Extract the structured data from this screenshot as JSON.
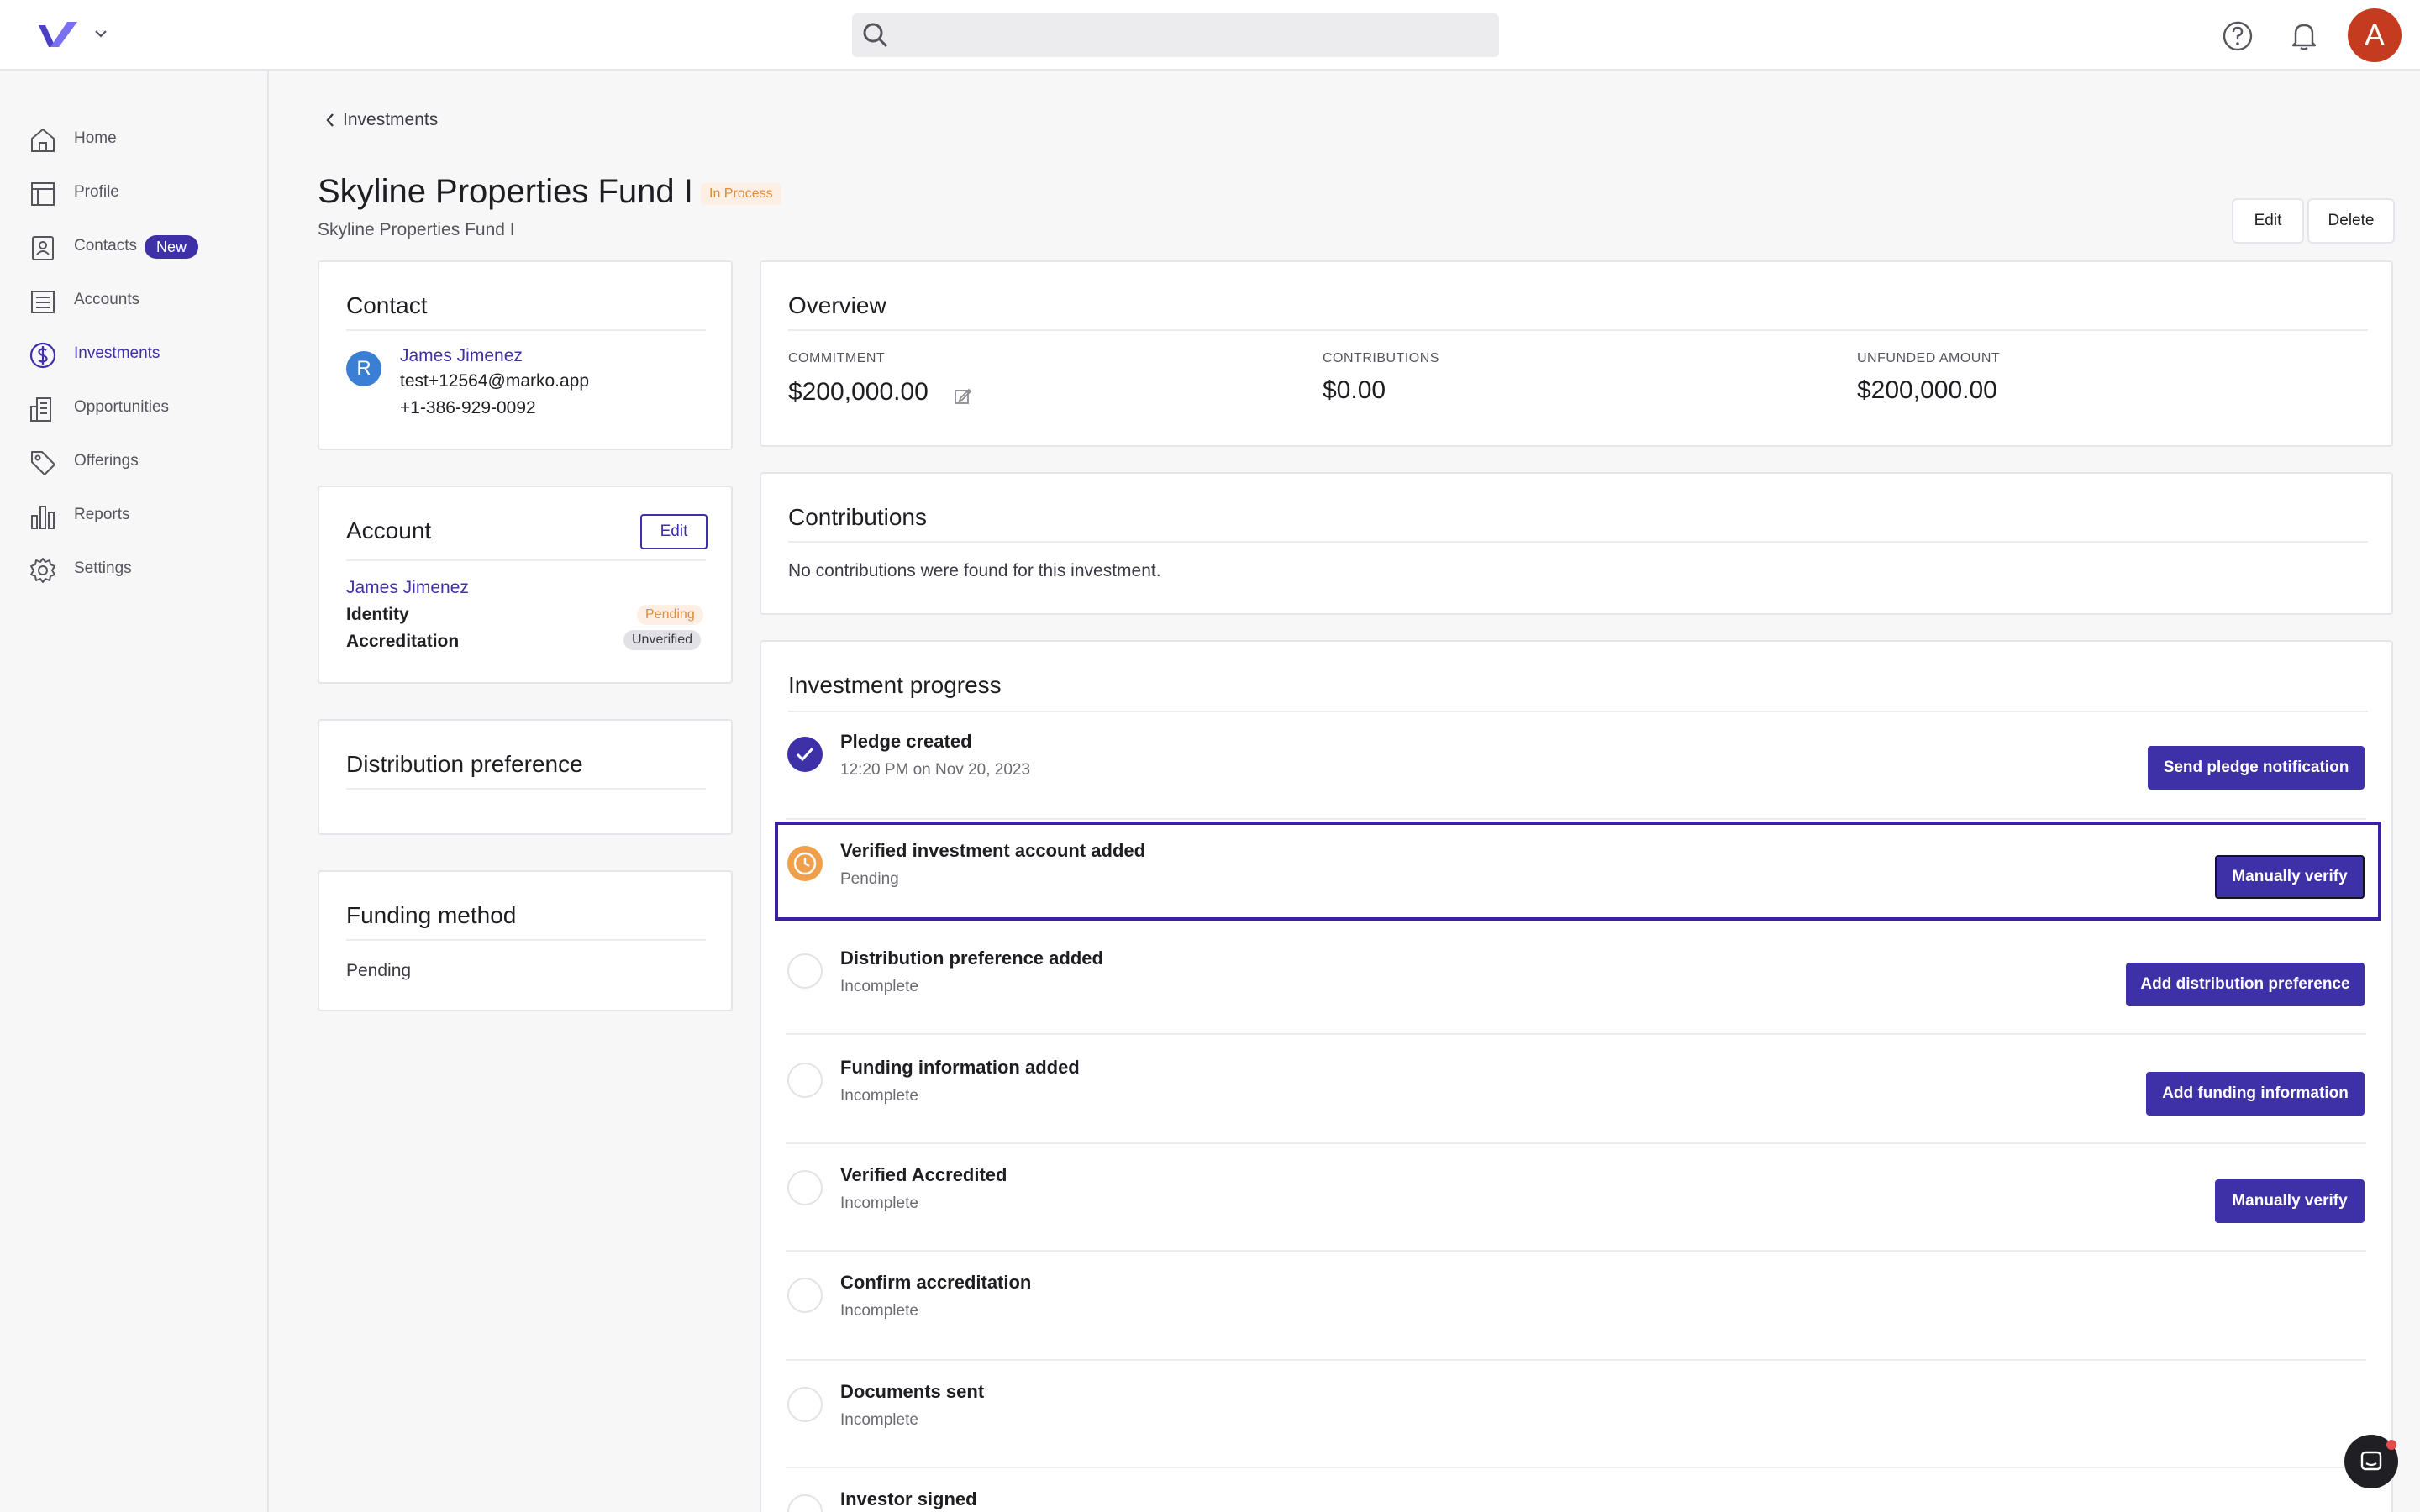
{
  "header": {
    "search_placeholder": "",
    "avatar_initial": "A"
  },
  "sidebar": {
    "items": [
      {
        "label": "Home",
        "icon": "home-icon"
      },
      {
        "label": "Profile",
        "icon": "profile-icon"
      },
      {
        "label": "Contacts",
        "icon": "contacts-icon",
        "badge": "New"
      },
      {
        "label": "Accounts",
        "icon": "accounts-icon"
      },
      {
        "label": "Investments",
        "icon": "dollar-icon",
        "active": true
      },
      {
        "label": "Opportunities",
        "icon": "building-icon"
      },
      {
        "label": "Offerings",
        "icon": "tag-icon"
      },
      {
        "label": "Reports",
        "icon": "bar-chart-icon"
      },
      {
        "label": "Settings",
        "icon": "gear-icon"
      }
    ]
  },
  "page": {
    "back_label": "Investments",
    "title": "Skyline Properties Fund I",
    "status": "In Process",
    "subtitle": "Skyline Properties Fund I",
    "edit_label": "Edit",
    "delete_label": "Delete"
  },
  "contact": {
    "title": "Contact",
    "initial": "R",
    "name": "James Jimenez",
    "email": "test+12564@marko.app",
    "phone": "+1-386-929-0092"
  },
  "account": {
    "title": "Account",
    "edit_label": "Edit",
    "name": "James Jimenez",
    "identity_label": "Identity",
    "identity_status": "Pending",
    "accreditation_label": "Accreditation",
    "accreditation_status": "Unverified"
  },
  "distribution": {
    "title": "Distribution preference"
  },
  "funding": {
    "title": "Funding method",
    "value": "Pending"
  },
  "overview": {
    "title": "Overview",
    "commitment_label": "COMMITMENT",
    "commitment_value": "$200,000.00",
    "contributions_label": "CONTRIBUTIONS",
    "contributions_value": "$0.00",
    "unfunded_label": "UNFUNDED AMOUNT",
    "unfunded_value": "$200,000.00"
  },
  "contributions": {
    "title": "Contributions",
    "empty_text": "No contributions were found for this investment."
  },
  "progress": {
    "title": "Investment progress",
    "steps": [
      {
        "title": "Pledge created",
        "sub": "12:20 PM on Nov 20, 2023",
        "state": "done",
        "action": "Send pledge notification"
      },
      {
        "title": "Verified investment account added",
        "sub": "Pending",
        "state": "pending",
        "action": "Manually verify"
      },
      {
        "title": "Distribution preference added",
        "sub": "Incomplete",
        "state": "incomplete",
        "action": "Add distribution preference"
      },
      {
        "title": "Funding information added",
        "sub": "Incomplete",
        "state": "incomplete",
        "action": "Add funding information"
      },
      {
        "title": "Verified Accredited",
        "sub": "Incomplete",
        "state": "incomplete",
        "action": "Manually verify"
      },
      {
        "title": "Confirm accreditation",
        "sub": "Incomplete",
        "state": "incomplete",
        "action": ""
      },
      {
        "title": "Documents sent",
        "sub": "Incomplete",
        "state": "incomplete",
        "action": ""
      },
      {
        "title": "Investor signed",
        "sub": "",
        "state": "incomplete",
        "action": ""
      }
    ]
  },
  "colors": {
    "accent": "#3e31a8",
    "pending": "#f0a04b",
    "highlight_border": "#3a1fa3"
  }
}
